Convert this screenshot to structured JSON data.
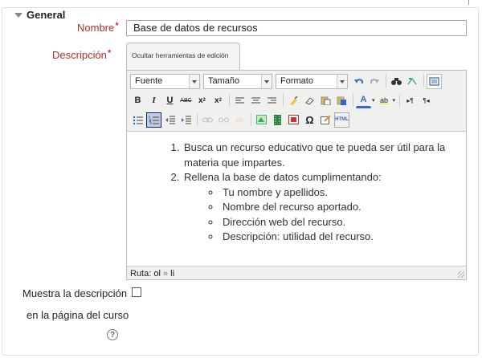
{
  "section": {
    "title": "General"
  },
  "fields": {
    "name": {
      "label": "Nombre",
      "required_mark": "*",
      "value": "Base de datos de recursos"
    },
    "description": {
      "label": "Descripción",
      "required_mark": "*",
      "toggle_tab": "Ocultar herramientas de edición"
    }
  },
  "editor": {
    "font_select": "Fuente",
    "size_select": "Tamaño",
    "format_select": "Formato",
    "content": {
      "ordered": [
        {
          "text": "Busca un recurso educativo que te pueda ser útil para la materia que impartes."
        },
        {
          "text": "Rellena la base de datos cumplimentando:",
          "sub": [
            "Tu nombre y apellidos.",
            "Nombre del recurso aportado.",
            "Dirección web del recurso.",
            "Descripción: utilidad del recurso."
          ]
        }
      ]
    },
    "path": {
      "label": "Ruta:",
      "first": "ol",
      "sep": "»",
      "second": "li"
    }
  },
  "show_description": {
    "label_line1": "Muestra la descripción",
    "label_line2": "en la página del curso",
    "checked": false
  },
  "help_icon_glyph": "?"
}
